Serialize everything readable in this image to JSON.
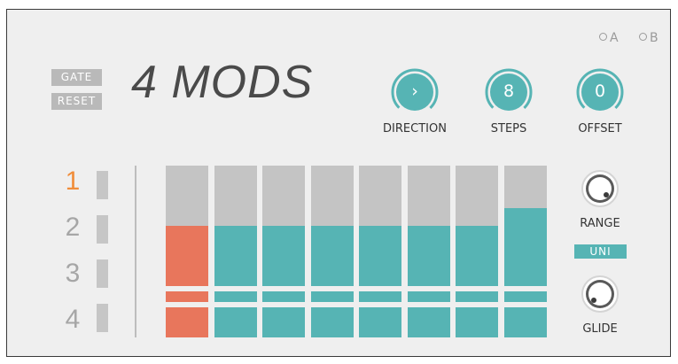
{
  "header": {
    "title": "4 MODS",
    "gate_label": "GATE",
    "reset_label": "RESET",
    "preset_a": "A",
    "preset_b": "B"
  },
  "knobs": {
    "direction": {
      "label": "DIRECTION",
      "value": "›"
    },
    "steps": {
      "label": "STEPS",
      "value": "8"
    },
    "offset": {
      "label": "OFFSET",
      "value": "0"
    }
  },
  "rows": [
    {
      "label": "1",
      "active": true
    },
    {
      "label": "2",
      "active": false
    },
    {
      "label": "3",
      "active": false
    },
    {
      "label": "4",
      "active": false
    }
  ],
  "steps": [
    {
      "level": 0.5,
      "active": true
    },
    {
      "level": 0.5,
      "active": false
    },
    {
      "level": 0.5,
      "active": false
    },
    {
      "level": 0.5,
      "active": false
    },
    {
      "level": 0.5,
      "active": false
    },
    {
      "level": 0.5,
      "active": false
    },
    {
      "level": 0.5,
      "active": false
    },
    {
      "level": 0.65,
      "active": false
    }
  ],
  "controls": {
    "range_label": "RANGE",
    "glide_label": "GLIDE",
    "uni_label": "UNI"
  },
  "colors": {
    "teal": "#56b4b4",
    "orange": "#e8765c",
    "inactive_bar": "#c4c4c4",
    "highlight": "#f08d3a"
  }
}
